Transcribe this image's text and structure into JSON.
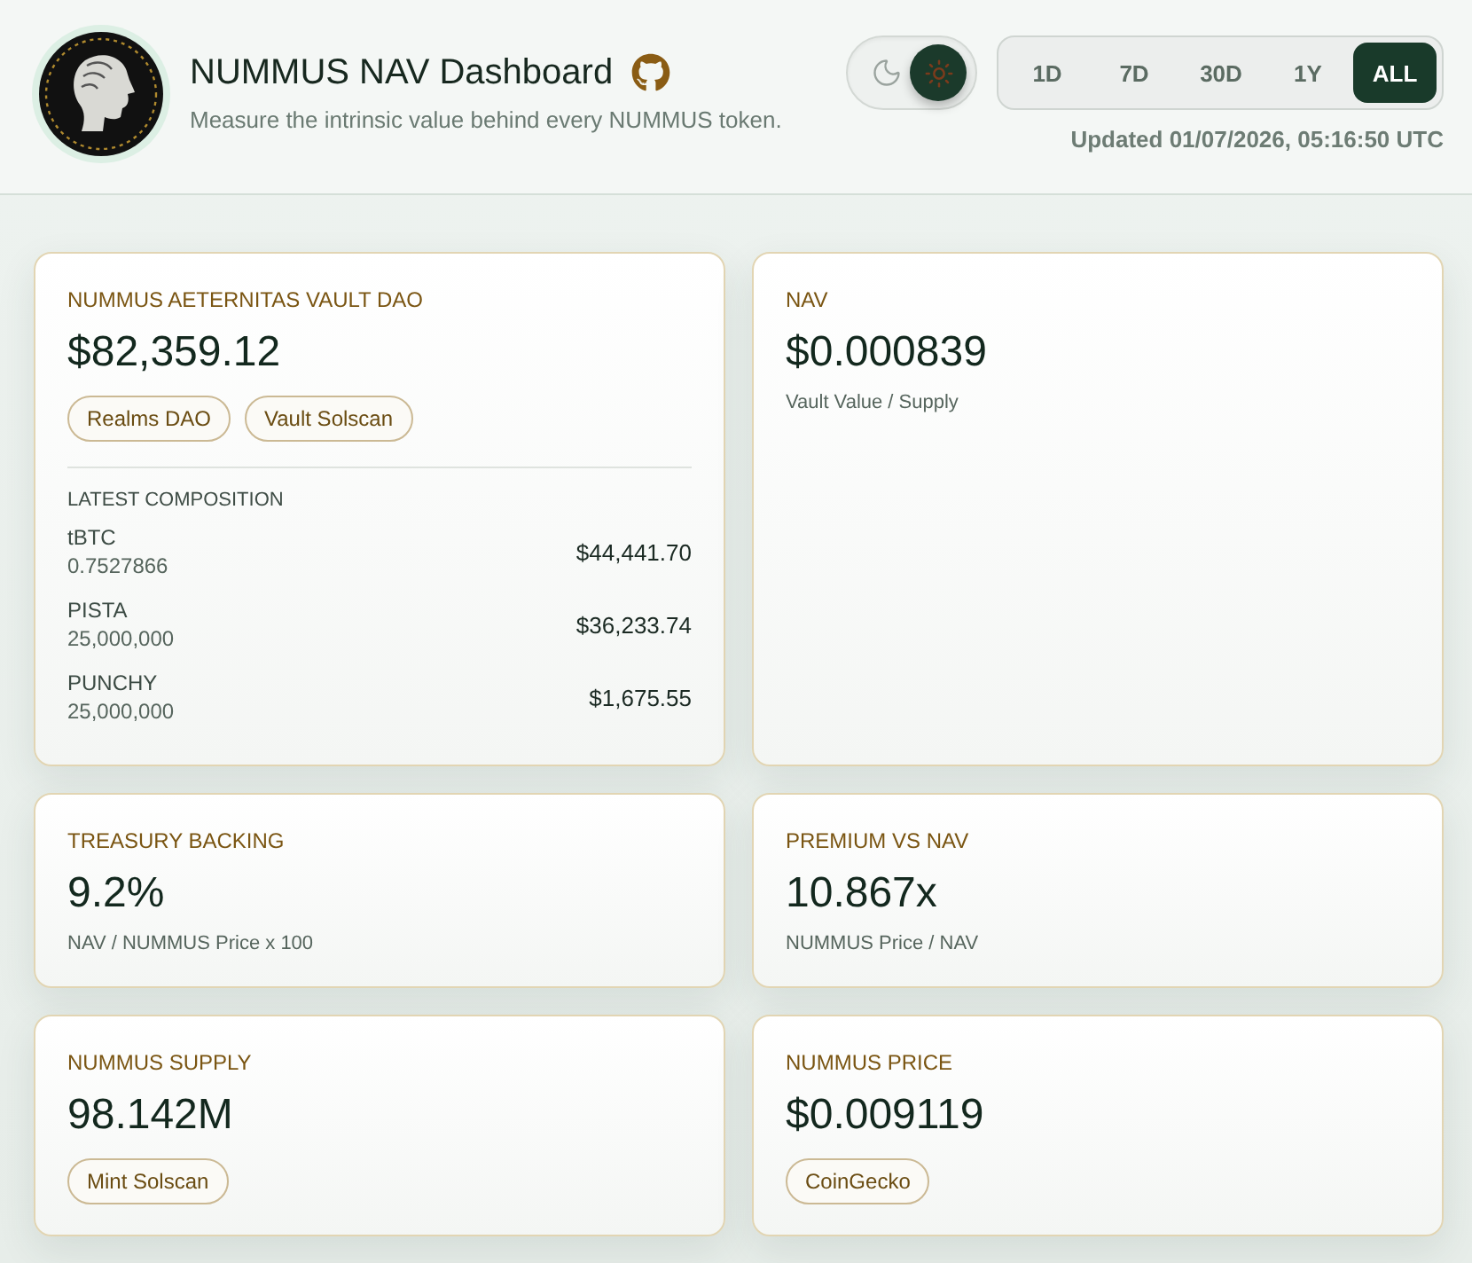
{
  "header": {
    "title": "NUMMUS NAV Dashboard",
    "subtitle": "Measure the intrinsic value behind every NUMMUS token.",
    "dark_mode": false,
    "periods": [
      {
        "label": "1D",
        "selected": false
      },
      {
        "label": "7D",
        "selected": false
      },
      {
        "label": "30D",
        "selected": false
      },
      {
        "label": "1Y",
        "selected": false
      },
      {
        "label": "ALL",
        "selected": true
      }
    ],
    "updated": "Updated 01/07/2026, 05:16:50 UTC"
  },
  "cards": [
    {
      "kind": "vault",
      "label": "NUMMUS AETERNITAS VAULT DAO",
      "value": "$82,359.12",
      "links": [
        "Realms DAO",
        "Vault Solscan"
      ],
      "composition": {
        "heading": "LATEST COMPOSITION",
        "items": [
          {
            "asset": "tBTC",
            "amount": "0.7527866",
            "value": "$44,441.70"
          },
          {
            "asset": "PISTA",
            "amount": "25,000,000",
            "value": "$36,233.74"
          },
          {
            "asset": "PUNCHY",
            "amount": "25,000,000",
            "value": "$1,675.55"
          }
        ]
      }
    },
    {
      "kind": "metric",
      "label": "NAV",
      "value": "$0.000839",
      "note": "Vault Value / Supply"
    },
    {
      "kind": "metric",
      "label": "TREASURY BACKING",
      "value": "9.2%",
      "note": "NAV / NUMMUS Price x 100"
    },
    {
      "kind": "metric",
      "label": "PREMIUM VS NAV",
      "value": "10.867x",
      "note": "NUMMUS Price / NAV"
    },
    {
      "kind": "metric",
      "label": "NUMMUS SUPPLY",
      "value": "98.142M",
      "links": [
        "Mint Solscan"
      ]
    },
    {
      "kind": "metric",
      "label": "NUMMUS PRICE",
      "value": "$0.009119",
      "links": [
        "CoinGecko"
      ]
    }
  ]
}
